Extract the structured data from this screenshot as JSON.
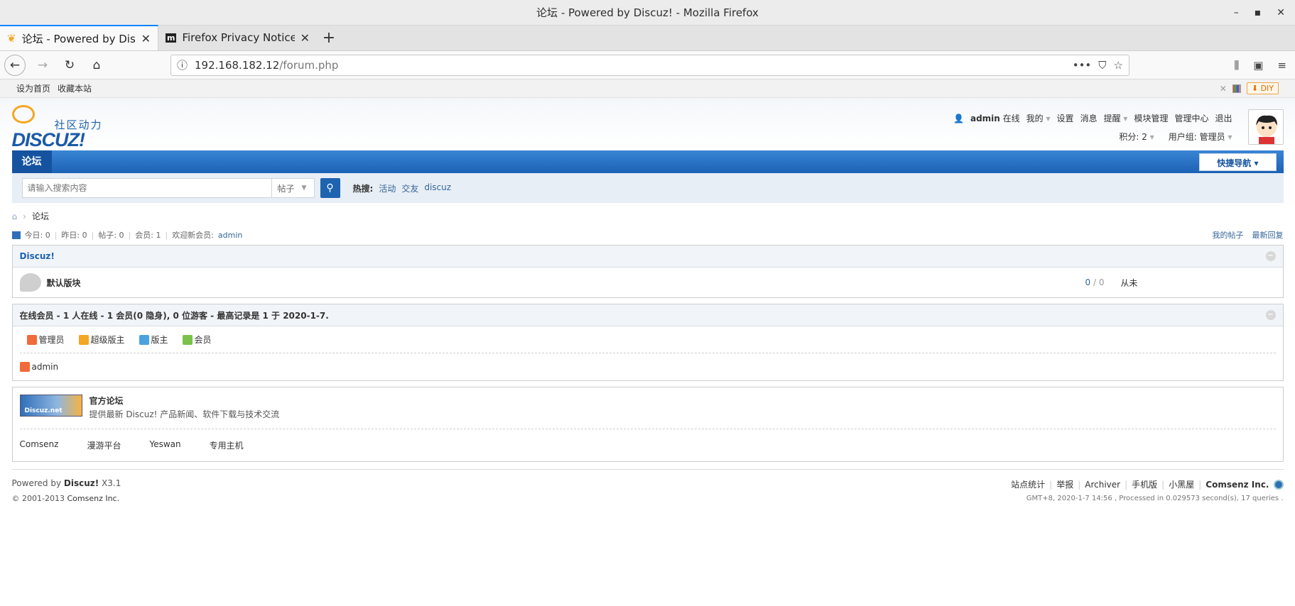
{
  "window": {
    "title": "论坛 - Powered by Discuz! - Mozilla Firefox"
  },
  "tabs": [
    {
      "label": "论坛 - Powered by Discuz",
      "active": true
    },
    {
      "label": "Firefox Privacy Notice — ",
      "active": false
    }
  ],
  "urlbar": {
    "host": "192.168.182.12",
    "path": "/forum.php"
  },
  "topbar": {
    "set_home": "设为首页",
    "favorite": "收藏本站",
    "diy": "DIY"
  },
  "logo": {
    "cn": "社区动力",
    "en": "DISCUZ!"
  },
  "user": {
    "name": "admin",
    "status": "在线",
    "mine": "我的",
    "settings": "设置",
    "messages": "消息",
    "remind": "提醒",
    "module_manage": "模块管理",
    "admin_center": "管理中心",
    "logout": "退出",
    "points": "积分: 2",
    "group": "用户组: 管理员"
  },
  "nav": {
    "current": "论坛",
    "quick": "快捷导航"
  },
  "search": {
    "placeholder": "请输入搜索内容",
    "type": "帖子",
    "hot_label": "热搜:",
    "hot": [
      "活动",
      "交友",
      "discuz"
    ]
  },
  "breadcrumb": {
    "current": "论坛"
  },
  "stats": {
    "today": "今日: 0",
    "yesterday": "昨日: 0",
    "posts": "帖子: 0",
    "members": "会员: 1",
    "welcome": "欢迎新会员:",
    "new_member": "admin",
    "my_posts": "我的帖子",
    "latest_reply": "最新回复"
  },
  "category": {
    "title": "Discuz!",
    "forum": {
      "name": "默认版块",
      "count_a": "0",
      "count_b": "0",
      "last": "从未"
    }
  },
  "online": {
    "title": "在线会员 - 1 人在线 - 1 会员(0 隐身), 0 位游客 - 最高记录是 1 于 2020-1-7.",
    "legend": [
      "管理员",
      "超级版主",
      "版主",
      "会员"
    ],
    "members": [
      "admin"
    ]
  },
  "links": {
    "title": "官方论坛",
    "desc": "提供最新 Discuz! 产品新闻、软件下载与技术交流",
    "logo_text": "Discuz.net",
    "items": [
      "Comsenz",
      "漫游平台",
      "Yeswan",
      "专用主机"
    ]
  },
  "footer": {
    "powered": "Powered by",
    "brand": "Discuz!",
    "version": "X3.1",
    "copyright": "© 2001-2013",
    "company": "Comsenz Inc.",
    "links": [
      "站点统计",
      "举报",
      "Archiver",
      "手机版",
      "小黑屋"
    ],
    "company_bold": "Comsenz Inc.",
    "runtime": "GMT+8, 2020-1-7 14:56 , Processed in 0.029573 second(s), 17 queries ."
  },
  "colors": {
    "accent": "#1e63b0",
    "tab_active": "#0a84ff",
    "link": "#336699"
  }
}
